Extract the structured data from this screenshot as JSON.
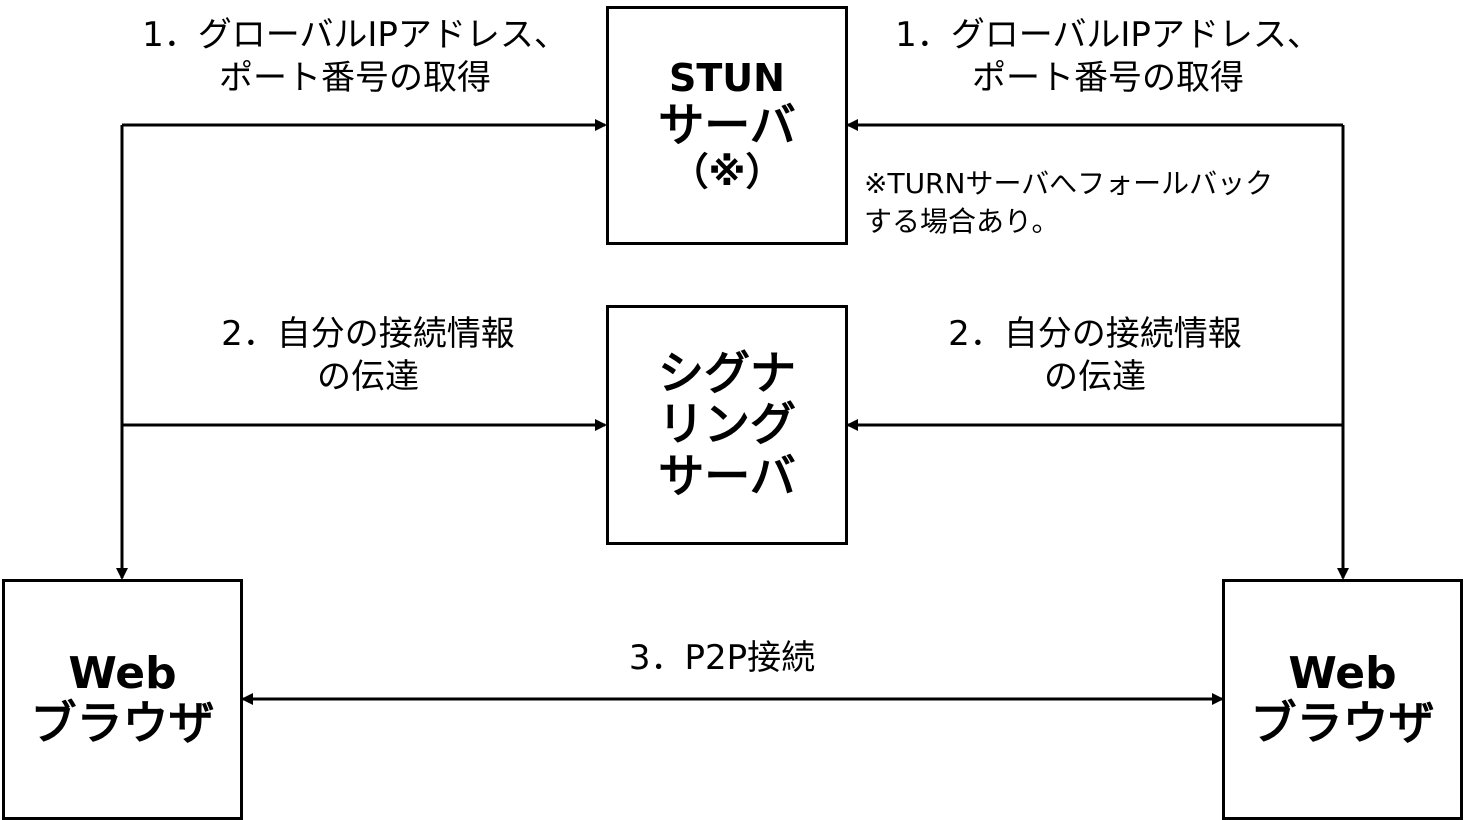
{
  "stun_server": {
    "line1": "STUN",
    "line2": "サーバ",
    "line3": "（※）"
  },
  "signaling_server": {
    "line1": "シグナ",
    "line2": "リング",
    "line3": "サーバ"
  },
  "browser_left": {
    "line1": "Web",
    "line2": "ブラウザ"
  },
  "browser_right": {
    "line1": "Web",
    "line2": "ブラウザ"
  },
  "step1_left": {
    "line1": "1．グローバルIPアドレス、",
    "line2": "ポート番号の取得"
  },
  "step1_right": {
    "line1": "1．グローバルIPアドレス、",
    "line2": "ポート番号の取得"
  },
  "step2_left": {
    "line1": "2．自分の接続情報",
    "line2": "の伝達"
  },
  "step2_right": {
    "line1": "2．自分の接続情報",
    "line2": "の伝達"
  },
  "step3": {
    "label": "3．P2P接続"
  },
  "turn_note": {
    "line1": "※TURNサーバへフォールバック",
    "line2": "する場合あり。"
  }
}
